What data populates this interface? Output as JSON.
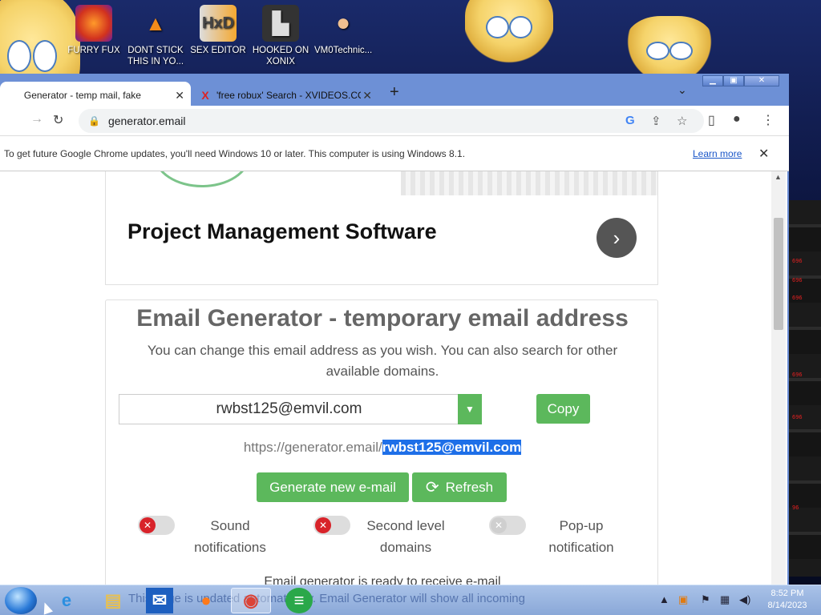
{
  "desktop": {
    "icons": [
      {
        "label": "FURRY FUX",
        "icon": "firefox-icon"
      },
      {
        "label": "DONT STICK THIS IN YO...",
        "icon": "vlc-icon"
      },
      {
        "label": "SEX EDITOR",
        "icon": "hxd-icon"
      },
      {
        "label": "HOOKED ON XONIX",
        "icon": "game-icon"
      },
      {
        "label": "VM0Technic...",
        "icon": "doctor-icon"
      }
    ]
  },
  "browser": {
    "tabs": [
      {
        "title": "Generator - temp mail, fake",
        "active": true
      },
      {
        "title": "'free robux' Search - XVIDEOS.CO",
        "active": false
      }
    ],
    "url": "generator.email",
    "infobar": {
      "message": "To get future Google Chrome updates, you'll need Windows 10 or later. This computer is using Windows 8.1.",
      "learn_more": "Learn more"
    }
  },
  "page": {
    "ad": {
      "title": "Project Management Software",
      "arrow": "›"
    },
    "heading": "Email Generator - temporary email address",
    "subtitle": "You can change this email address as you wish. You can also search for other available domains.",
    "email": "rwbst125@emvil.com",
    "copy_label": "Copy",
    "url_prefix": "https://generator.email/",
    "url_email": "rwbst125@emvil.com",
    "generate_label": "Generate new e-mail",
    "refresh_label": "Refresh",
    "toggles": [
      {
        "label": "Sound notifications",
        "state": "off-red"
      },
      {
        "label": "Second level domains",
        "state": "off-red"
      },
      {
        "label": "Pop-up notification",
        "state": "disabled"
      }
    ],
    "status": "Email generator is ready to receive e-mail",
    "ghost_text": "This page is updated automatically. Email Generator will show all incoming"
  },
  "taskbar": {
    "time": "8:52 PM",
    "date": "8/14/2023"
  },
  "colors": {
    "accent_green": "#5cb85c",
    "highlight": "#1e6fe8",
    "taskbar": "#a9c2e8"
  }
}
